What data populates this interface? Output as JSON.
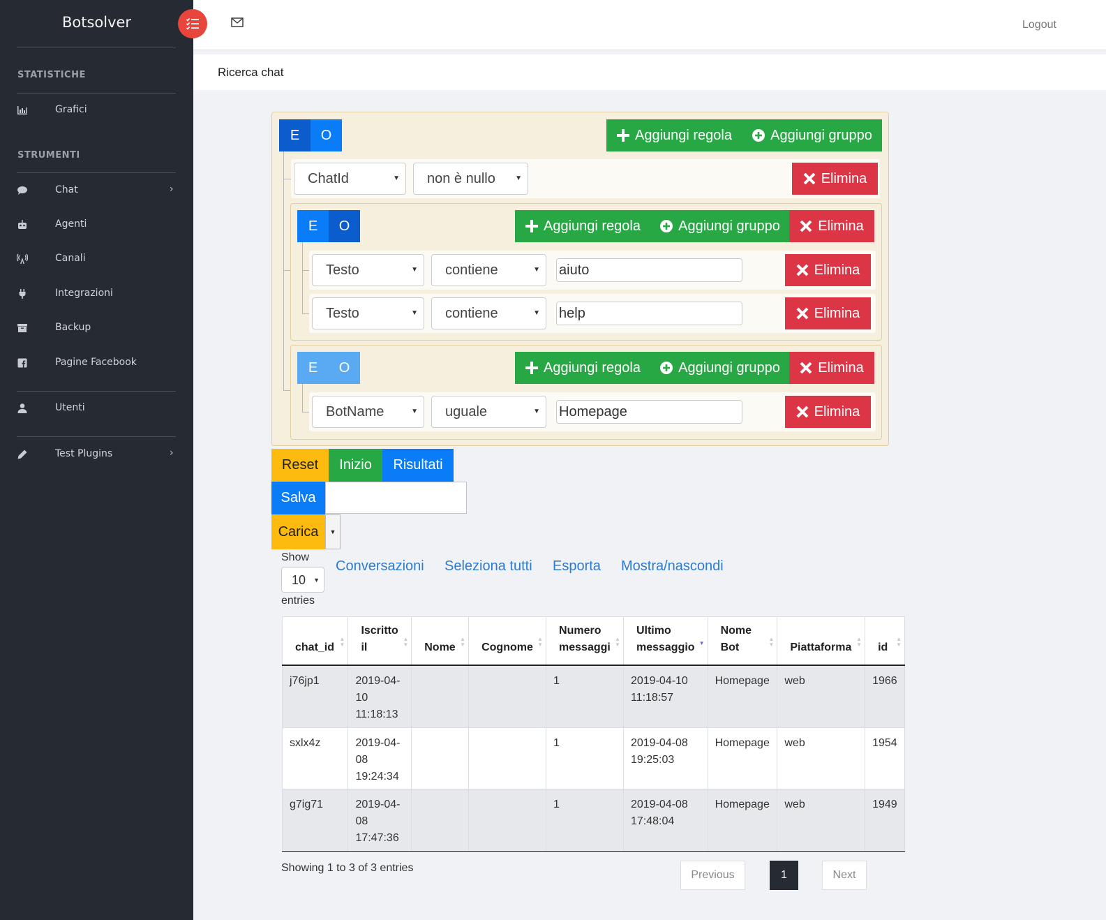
{
  "brand": "Botsolver",
  "header": {
    "logout": "Logout"
  },
  "page_title": "Ricerca chat",
  "sidebar": {
    "sections": [
      "STATISTICHE",
      "STRUMENTI"
    ],
    "items": [
      {
        "label": "Grafici",
        "icon": "bar-chart-icon"
      },
      {
        "label": "Chat",
        "icon": "chat-icon"
      },
      {
        "label": "Agenti",
        "icon": "robot-icon"
      },
      {
        "label": "Canali",
        "icon": "broadcast-icon"
      },
      {
        "label": "Integrazioni",
        "icon": "plug-icon"
      },
      {
        "label": "Backup",
        "icon": "archive-icon"
      },
      {
        "label": "Pagine Facebook",
        "icon": "facebook-icon"
      },
      {
        "label": "Utenti",
        "icon": "user-icon"
      },
      {
        "label": "Test Plugins",
        "icon": "pencil-icon"
      }
    ]
  },
  "query_builder": {
    "cond_and": "E",
    "cond_or": "O",
    "add_rule": "Aggiungi regola",
    "add_group": "Aggiungi gruppo",
    "delete": "Elimina",
    "root_rule": {
      "field": "ChatId",
      "operator": "non è nullo"
    },
    "group1_rules": [
      {
        "field": "Testo",
        "operator": "contiene",
        "value": "aiuto"
      },
      {
        "field": "Testo",
        "operator": "contiene",
        "value": "help"
      }
    ],
    "group2_rules": [
      {
        "field": "BotName",
        "operator": "uguale",
        "value": "Homepage"
      }
    ]
  },
  "actions": {
    "reset": "Reset",
    "inizio": "Inizio",
    "risultati": "Risultati",
    "salva": "Salva",
    "carica": "Carica"
  },
  "datatable": {
    "show": "Show",
    "length": "10",
    "entries": "entries",
    "buttons": [
      "Conversazioni",
      "Seleziona tutti",
      "Esporta",
      "Mostra/nascondi"
    ],
    "columns": [
      {
        "l1": "",
        "l2": "chat_id"
      },
      {
        "l1": "Iscritto",
        "l2": "il"
      },
      {
        "l1": "",
        "l2": "Nome"
      },
      {
        "l1": "",
        "l2": "Cognome"
      },
      {
        "l1": "Numero",
        "l2": "messaggi"
      },
      {
        "l1": "Ultimo",
        "l2": "messaggio"
      },
      {
        "l1": "Nome",
        "l2": "Bot"
      },
      {
        "l1": "",
        "l2": "Piattaforma"
      },
      {
        "l1": "",
        "l2": "id"
      }
    ],
    "rows": [
      {
        "chat_id": "j76jp1",
        "iscritto": [
          "2019-04-",
          "10",
          "11:18:13"
        ],
        "nome": "",
        "cognome": "",
        "num": "1",
        "ultimo": [
          "2019-04-10",
          "11:18:57"
        ],
        "bot": "Homepage",
        "piattaforma": "web",
        "id": "1966"
      },
      {
        "chat_id": "sxlx4z",
        "iscritto": [
          "2019-04-",
          "08",
          "19:24:34"
        ],
        "nome": "",
        "cognome": "",
        "num": "1",
        "ultimo": [
          "2019-04-08",
          "19:25:03"
        ],
        "bot": "Homepage",
        "piattaforma": "web",
        "id": "1954"
      },
      {
        "chat_id": "g7ig71",
        "iscritto": [
          "2019-04-",
          "08",
          "17:47:36"
        ],
        "nome": "",
        "cognome": "",
        "num": "1",
        "ultimo": [
          "2019-04-08",
          "17:48:04"
        ],
        "bot": "Homepage",
        "piattaforma": "web",
        "id": "1949"
      }
    ],
    "info": "Showing 1 to 3 of 3 entries",
    "pagination": {
      "previous": "Previous",
      "current": "1",
      "next": "Next"
    }
  }
}
